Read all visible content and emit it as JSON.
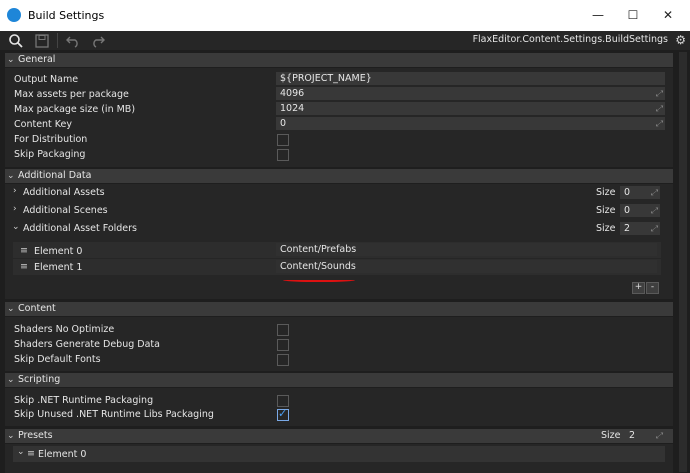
{
  "window": {
    "title": "Build Settings",
    "minimize_icon": "—",
    "maximize_icon": "☐",
    "close_icon": "✕"
  },
  "toolbar": {
    "asset_path": "FlaxEditor.Content.Settings.BuildSettings",
    "icons": [
      "search-icon",
      "save-icon",
      "undo-icon",
      "redo-icon",
      "gear-icon"
    ]
  },
  "general": {
    "title": "General",
    "output_name_label": "Output Name",
    "output_name_value": "${PROJECT_NAME}",
    "max_assets_label": "Max assets per package",
    "max_assets_value": "4096",
    "max_package_size_label": "Max package size (in MB)",
    "max_package_size_value": "1024",
    "content_key_label": "Content Key",
    "content_key_value": "0",
    "for_distribution_label": "For Distribution",
    "for_distribution_checked": false,
    "skip_packaging_label": "Skip Packaging",
    "skip_packaging_checked": false
  },
  "additional_data": {
    "title": "Additional Data",
    "size_label": "Size",
    "additional_assets_label": "Additional Assets",
    "additional_assets_size": "0",
    "additional_scenes_label": "Additional Scenes",
    "additional_scenes_size": "0",
    "additional_asset_folders_label": "Additional Asset Folders",
    "additional_asset_folders_size": "2",
    "elements": [
      {
        "label": "Element 0",
        "value": "Content/Prefabs"
      },
      {
        "label": "Element 1",
        "value": "Content/Sounds"
      }
    ],
    "add_label": "+",
    "remove_label": "-"
  },
  "content": {
    "title": "Content",
    "shaders_no_optimize_label": "Shaders No Optimize",
    "shaders_no_optimize_checked": false,
    "shaders_debug_label": "Shaders Generate Debug Data",
    "shaders_debug_checked": false,
    "skip_default_fonts_label": "Skip Default Fonts",
    "skip_default_fonts_checked": false
  },
  "scripting": {
    "title": "Scripting",
    "skip_net_runtime_label": "Skip .NET Runtime Packaging",
    "skip_net_runtime_checked": false,
    "skip_unused_libs_label": "Skip Unused .NET Runtime Libs Packaging",
    "skip_unused_libs_checked": true
  },
  "presets": {
    "title": "Presets",
    "size_label": "Size",
    "size_value": "2",
    "element0_label": "Element 0"
  },
  "colors": {
    "background": "#1e1e1e",
    "section_header": "#3a3a3a",
    "field": "#383838",
    "accent": "#4a9ff5",
    "annotation": "#dd1111"
  }
}
